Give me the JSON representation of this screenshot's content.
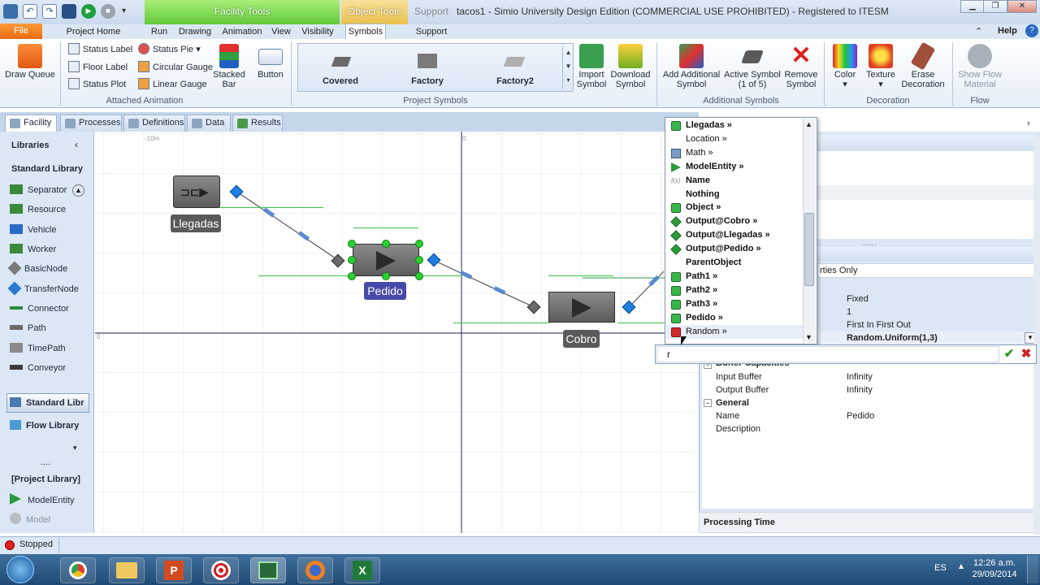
{
  "window": {
    "title": "tacos1 - Simio University Design Edition (COMMERCIAL USE PROHIBITED) - Registered to ITESM",
    "context_tabs": [
      "Facility Tools",
      "Object Tools",
      "Support"
    ],
    "controls": [
      "minimize",
      "maximize",
      "close"
    ]
  },
  "ribbon_tabs": {
    "file": "File",
    "items": [
      "Project Home",
      "Run",
      "Drawing",
      "Animation",
      "View",
      "Visibility",
      "Symbols",
      "Support"
    ],
    "active": "Symbols",
    "help": "Help"
  },
  "ribbon": {
    "draw_queue": "Draw Queue",
    "attached_animation": {
      "label": "Attached Animation",
      "small": [
        "Status Label",
        "Floor Label",
        "Status Plot",
        "Status Pie",
        "Circular Gauge",
        "Linear Gauge"
      ],
      "stacked_bar": "Stacked Bar",
      "button": "Button"
    },
    "project_symbols": {
      "label": "Project Symbols",
      "items": [
        "Covered",
        "Factory",
        "Factory2"
      ]
    },
    "import_symbol": "Import Symbol",
    "download_symbol": "Download Symbol",
    "additional_symbols": {
      "label": "Additional Symbols",
      "add": "Add Additional Symbol",
      "active": "Active Symbol (1 of 5)",
      "remove": "Remove Symbol"
    },
    "decoration": {
      "label": "Decoration",
      "items": [
        "Color",
        "Texture",
        "Erase Decoration"
      ]
    },
    "flow": {
      "label": "Flow",
      "show": "Show Flow Material"
    }
  },
  "doc_tabs": [
    "Facility",
    "Processes",
    "Definitions",
    "Data",
    "Results"
  ],
  "libraries": {
    "title": "Libraries",
    "standard_title": "Standard Library",
    "standard_items": [
      "Separator",
      "Resource",
      "Vehicle",
      "Worker",
      "BasicNode",
      "TransferNode",
      "Connector",
      "Path",
      "TimePath",
      "Conveyor"
    ],
    "tabs": [
      "Standard Libr",
      "Flow Library"
    ],
    "project_title": "[Project Library]",
    "project_items": [
      "ModelEntity",
      "Model"
    ]
  },
  "canvas": {
    "ruler_left": "-10m",
    "ruler_zero": "0",
    "objects": [
      "Llegadas",
      "Pedido",
      "Cobro"
    ]
  },
  "dropdown": {
    "items": [
      {
        "label": "Llegadas »",
        "bold": true,
        "icon": "green-cube"
      },
      {
        "label": "Location »",
        "bold": false,
        "icon": "none"
      },
      {
        "label": "Math »",
        "bold": false,
        "icon": "table"
      },
      {
        "label": "ModelEntity »",
        "bold": true,
        "icon": "green-triangle"
      },
      {
        "label": "Name",
        "bold": true,
        "icon": "fx"
      },
      {
        "label": "Nothing",
        "bold": true,
        "icon": "none"
      },
      {
        "label": "Object »",
        "bold": true,
        "icon": "green-cube"
      },
      {
        "label": "Output@Cobro »",
        "bold": true,
        "icon": "green-diamond"
      },
      {
        "label": "Output@Llegadas »",
        "bold": true,
        "icon": "green-diamond"
      },
      {
        "label": "Output@Pedido »",
        "bold": true,
        "icon": "green-diamond"
      },
      {
        "label": "ParentObject",
        "bold": true,
        "icon": "none"
      },
      {
        "label": "Path1 »",
        "bold": true,
        "icon": "green-cube"
      },
      {
        "label": "Path2 »",
        "bold": true,
        "icon": "green-cube"
      },
      {
        "label": "Path3 »",
        "bold": true,
        "icon": "green-cube"
      },
      {
        "label": "Pedido »",
        "bold": true,
        "icon": "green-cube"
      },
      {
        "label": "Random »",
        "bold": false,
        "icon": "red-dice"
      }
    ],
    "input_value": "r"
  },
  "properties": {
    "filter": "rties Only",
    "rows": [
      {
        "name": "",
        "value": "Fixed"
      },
      {
        "name": "",
        "value": "1"
      },
      {
        "name": "",
        "value": "First In First Out"
      },
      {
        "name": "",
        "value": "Random.Uniform(1,3)"
      }
    ],
    "buffer_section": "Buffer Capacities",
    "input_buffer": {
      "name": "Input Buffer",
      "value": "Infinity"
    },
    "output_buffer": {
      "name": "Output Buffer",
      "value": "Infinity"
    },
    "general_section": "General",
    "name_row": {
      "name": "Name",
      "value": "Pedido"
    },
    "description_row": {
      "name": "Description",
      "value": ""
    },
    "help_title": "Processing Time"
  },
  "status": {
    "text": "Stopped"
  },
  "taskbar": {
    "lang": "ES",
    "time": "12:26 a.m.",
    "date": "29/09/2014"
  }
}
